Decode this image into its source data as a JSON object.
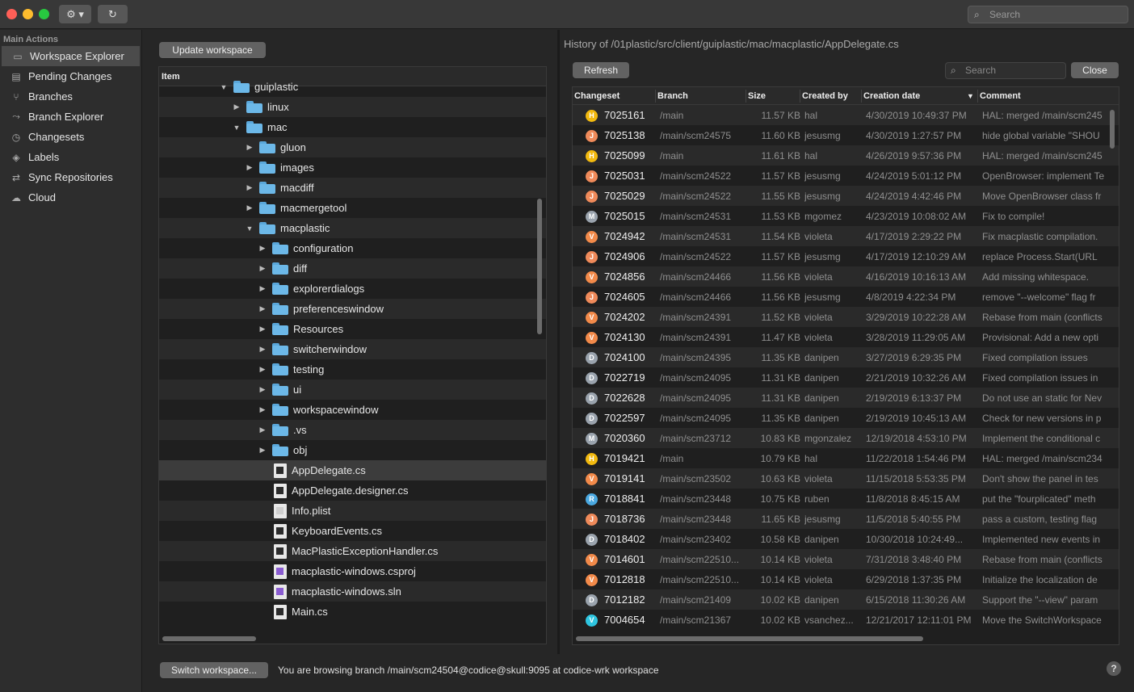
{
  "colors": {
    "close": "#ff5f57",
    "minimize": "#febc2e",
    "zoom": "#28c840",
    "folder": "#6cb8e8"
  },
  "titlebar": {
    "gear_label": "⚙ ▾",
    "refresh_label": "↻",
    "search_placeholder": "Search"
  },
  "sidebar": {
    "heading": "Main Actions",
    "items": [
      {
        "label": "Workspace Explorer",
        "icon": "folder-icon"
      },
      {
        "label": "Pending Changes",
        "icon": "pending-changes-icon"
      },
      {
        "label": "Branches",
        "icon": "branches-icon"
      },
      {
        "label": "Branch Explorer",
        "icon": "branch-explorer-icon"
      },
      {
        "label": "Changesets",
        "icon": "changesets-icon"
      },
      {
        "label": "Labels",
        "icon": "label-icon"
      },
      {
        "label": "Sync Repositories",
        "icon": "sync-icon"
      },
      {
        "label": "Cloud",
        "icon": "cloud-icon"
      }
    ]
  },
  "workspace": {
    "update_label": "Update workspace",
    "column_item": "Item",
    "tree": [
      {
        "name": "guiplastic",
        "type": "folder",
        "depth": 0,
        "expanded": true
      },
      {
        "name": "linux",
        "type": "folder",
        "depth": 1,
        "expanded": false
      },
      {
        "name": "mac",
        "type": "folder",
        "depth": 1,
        "expanded": true
      },
      {
        "name": "gluon",
        "type": "folder",
        "depth": 2,
        "expanded": false
      },
      {
        "name": "images",
        "type": "folder",
        "depth": 2,
        "expanded": false
      },
      {
        "name": "macdiff",
        "type": "folder",
        "depth": 2,
        "expanded": false
      },
      {
        "name": "macmergetool",
        "type": "folder",
        "depth": 2,
        "expanded": false
      },
      {
        "name": "macplastic",
        "type": "folder",
        "depth": 2,
        "expanded": true
      },
      {
        "name": "configuration",
        "type": "folder",
        "depth": 3,
        "expanded": false
      },
      {
        "name": "diff",
        "type": "folder",
        "depth": 3,
        "expanded": false
      },
      {
        "name": "explorerdialogs",
        "type": "folder",
        "depth": 3,
        "expanded": false
      },
      {
        "name": "preferenceswindow",
        "type": "folder",
        "depth": 3,
        "expanded": false
      },
      {
        "name": "Resources",
        "type": "folder",
        "depth": 3,
        "expanded": false
      },
      {
        "name": "switcherwindow",
        "type": "folder",
        "depth": 3,
        "expanded": false
      },
      {
        "name": "testing",
        "type": "folder",
        "depth": 3,
        "expanded": false
      },
      {
        "name": "ui",
        "type": "folder",
        "depth": 3,
        "expanded": false
      },
      {
        "name": "workspacewindow",
        "type": "folder",
        "depth": 3,
        "expanded": false
      },
      {
        "name": ".vs",
        "type": "folder",
        "depth": 3,
        "expanded": false
      },
      {
        "name": "obj",
        "type": "folder",
        "depth": 3,
        "expanded": false
      },
      {
        "name": "AppDelegate.cs",
        "type": "file",
        "depth": 3,
        "selected": true
      },
      {
        "name": "AppDelegate.designer.cs",
        "type": "file",
        "depth": 3
      },
      {
        "name": "Info.plist",
        "type": "plist",
        "depth": 3
      },
      {
        "name": "KeyboardEvents.cs",
        "type": "file",
        "depth": 3
      },
      {
        "name": "MacPlasticExceptionHandler.cs",
        "type": "file",
        "depth": 3
      },
      {
        "name": "macplastic-windows.csproj",
        "type": "vs",
        "depth": 3
      },
      {
        "name": "macplastic-windows.sln",
        "type": "vs",
        "depth": 3
      },
      {
        "name": "Main.cs",
        "type": "file",
        "depth": 3
      }
    ]
  },
  "history": {
    "title": "History of /01plastic/src/client/guiplastic/mac/macplastic/AppDelegate.cs",
    "refresh_label": "Refresh",
    "search_placeholder": "Search",
    "close_label": "Close",
    "columns": [
      "Changeset",
      "Branch",
      "Size",
      "Created by",
      "Creation date",
      "Comment"
    ],
    "rows": [
      {
        "letter": "H",
        "color": "#f2b90f",
        "cs": "7025161",
        "branch": "/main",
        "size": "11.57 KB",
        "by": "hal",
        "date": "4/30/2019 10:49:37 PM",
        "comment": "HAL: merged /main/scm245"
      },
      {
        "letter": "J",
        "color": "#ef8a5a",
        "cs": "7025138",
        "branch": "/main/scm24575",
        "size": "11.60 KB",
        "by": "jesusmg",
        "date": "4/30/2019 1:27:57 PM",
        "comment": "hide global variable \"SHOU"
      },
      {
        "letter": "H",
        "color": "#f2b90f",
        "cs": "7025099",
        "branch": "/main",
        "size": "11.61 KB",
        "by": "hal",
        "date": "4/26/2019 9:57:36 PM",
        "comment": "HAL: merged /main/scm245"
      },
      {
        "letter": "J",
        "color": "#ef8a5a",
        "cs": "7025031",
        "branch": "/main/scm24522",
        "size": "11.57 KB",
        "by": "jesusmg",
        "date": "4/24/2019 5:01:12 PM",
        "comment": "OpenBrowser: implement Te"
      },
      {
        "letter": "J",
        "color": "#ef8a5a",
        "cs": "7025029",
        "branch": "/main/scm24522",
        "size": "11.55 KB",
        "by": "jesusmg",
        "date": "4/24/2019 4:42:46 PM",
        "comment": "Move OpenBrowser class fr"
      },
      {
        "letter": "M",
        "color": "#9aa3ad",
        "cs": "7025015",
        "branch": "/main/scm24531",
        "size": "11.53 KB",
        "by": "mgomez",
        "date": "4/23/2019 10:08:02 AM",
        "comment": "Fix to compile!"
      },
      {
        "letter": "V",
        "color": "#f28a4a",
        "cs": "7024942",
        "branch": "/main/scm24531",
        "size": "11.54 KB",
        "by": "violeta",
        "date": "4/17/2019 2:29:22 PM",
        "comment": "Fix macplastic compilation."
      },
      {
        "letter": "J",
        "color": "#ef8a5a",
        "cs": "7024906",
        "branch": "/main/scm24522",
        "size": "11.57 KB",
        "by": "jesusmg",
        "date": "4/17/2019 12:10:29 AM",
        "comment": "replace  Process.Start(URL"
      },
      {
        "letter": "V",
        "color": "#f28a4a",
        "cs": "7024856",
        "branch": "/main/scm24466",
        "size": "11.56 KB",
        "by": "violeta",
        "date": "4/16/2019 10:16:13 AM",
        "comment": "Add missing whitespace."
      },
      {
        "letter": "J",
        "color": "#ef8a5a",
        "cs": "7024605",
        "branch": "/main/scm24466",
        "size": "11.56 KB",
        "by": "jesusmg",
        "date": "4/8/2019 4:22:34 PM",
        "comment": "remove \"--welcome\" flag fr"
      },
      {
        "letter": "V",
        "color": "#f28a4a",
        "cs": "7024202",
        "branch": "/main/scm24391",
        "size": "11.52 KB",
        "by": "violeta",
        "date": "3/29/2019 10:22:28 AM",
        "comment": "Rebase from main (conflicts"
      },
      {
        "letter": "V",
        "color": "#f28a4a",
        "cs": "7024130",
        "branch": "/main/scm24391",
        "size": "11.47 KB",
        "by": "violeta",
        "date": "3/28/2019 11:29:05 AM",
        "comment": "Provisional: Add a new opti"
      },
      {
        "letter": "D",
        "color": "#9aa3ad",
        "cs": "7024100",
        "branch": "/main/scm24395",
        "size": "11.35 KB",
        "by": "danipen",
        "date": "3/27/2019 6:29:35 PM",
        "comment": "Fixed compilation issues"
      },
      {
        "letter": "D",
        "color": "#9aa3ad",
        "cs": "7022719",
        "branch": "/main/scm24095",
        "size": "11.31 KB",
        "by": "danipen",
        "date": "2/21/2019 10:32:26 AM",
        "comment": "Fixed compilation issues in"
      },
      {
        "letter": "D",
        "color": "#9aa3ad",
        "cs": "7022628",
        "branch": "/main/scm24095",
        "size": "11.31 KB",
        "by": "danipen",
        "date": "2/19/2019 6:13:37 PM",
        "comment": "Do not use an static for Nev"
      },
      {
        "letter": "D",
        "color": "#9aa3ad",
        "cs": "7022597",
        "branch": "/main/scm24095",
        "size": "11.35 KB",
        "by": "danipen",
        "date": "2/19/2019 10:45:13 AM",
        "comment": "Check for new versions in p"
      },
      {
        "letter": "M",
        "color": "#9aa3ad",
        "cs": "7020360",
        "branch": "/main/scm23712",
        "size": "10.83 KB",
        "by": "mgonzalez",
        "date": "12/19/2018 4:53:10 PM",
        "comment": "Implement the conditional c"
      },
      {
        "letter": "H",
        "color": "#f2b90f",
        "cs": "7019421",
        "branch": "/main",
        "size": "10.79 KB",
        "by": "hal",
        "date": "11/22/2018 1:54:46 PM",
        "comment": "HAL: merged /main/scm234"
      },
      {
        "letter": "V",
        "color": "#f28a4a",
        "cs": "7019141",
        "branch": "/main/scm23502",
        "size": "10.63 KB",
        "by": "violeta",
        "date": "11/15/2018 5:53:35 PM",
        "comment": "Don't show the panel in tes"
      },
      {
        "letter": "R",
        "color": "#4aa8e0",
        "cs": "7018841",
        "branch": "/main/scm23448",
        "size": "10.75 KB",
        "by": "ruben",
        "date": "11/8/2018 8:45:15 AM",
        "comment": "put the \"fourplicated\" meth"
      },
      {
        "letter": "J",
        "color": "#ef8a5a",
        "cs": "7018736",
        "branch": "/main/scm23448",
        "size": "11.65 KB",
        "by": "jesusmg",
        "date": "11/5/2018 5:40:55 PM",
        "comment": "pass a custom, testing flag"
      },
      {
        "letter": "D",
        "color": "#9aa3ad",
        "cs": "7018402",
        "branch": "/main/scm23402",
        "size": "10.58 KB",
        "by": "danipen",
        "date": "10/30/2018 10:24:49...",
        "comment": "Implemented new events in"
      },
      {
        "letter": "V",
        "color": "#f28a4a",
        "cs": "7014601",
        "branch": "/main/scm22510...",
        "size": "10.14 KB",
        "by": "violeta",
        "date": "7/31/2018 3:48:40 PM",
        "comment": "Rebase from main (conflicts"
      },
      {
        "letter": "V",
        "color": "#f28a4a",
        "cs": "7012818",
        "branch": "/main/scm22510...",
        "size": "10.14 KB",
        "by": "violeta",
        "date": "6/29/2018 1:37:35 PM",
        "comment": "Initialize the localization de"
      },
      {
        "letter": "D",
        "color": "#9aa3ad",
        "cs": "7012182",
        "branch": "/main/scm21409",
        "size": "10.02 KB",
        "by": "danipen",
        "date": "6/15/2018 11:30:26 AM",
        "comment": "Support the \"--view\" param"
      },
      {
        "letter": "V",
        "color": "#2ec5e0",
        "cs": "7004654",
        "branch": "/main/scm21367",
        "size": "10.02 KB",
        "by": "vsanchez...",
        "date": "12/21/2017 12:11:01 PM",
        "comment": "Move the SwitchWorkspace"
      }
    ]
  },
  "status": {
    "switch_label": "Switch workspace...",
    "message": "You are browsing branch /main/scm24504@codice@skull:9095 at codice-wrk workspace",
    "help_label": "?"
  }
}
